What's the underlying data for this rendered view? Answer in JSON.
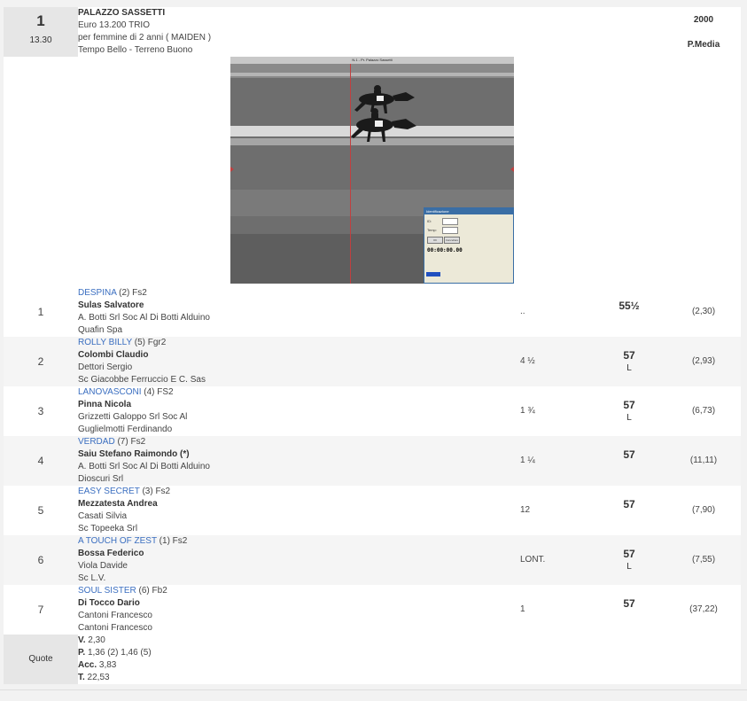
{
  "race": {
    "number": "1",
    "time": "13.30",
    "name": "PALAZZO SASSETTI",
    "prize": "Euro 13.200 TRIO",
    "conditions": "per femmine di 2 anni ( MAIDEN )",
    "weather": "Tempo Bello - Terreno Buono",
    "distance": "2000",
    "type": "P.Media"
  },
  "photo": {
    "title": "N.1 - Pr. Palazzo Sassetti",
    "dialog_title": "Identificazione",
    "field1_label": "ID:",
    "field2_label": "Temp:",
    "button1": "OK",
    "button2": "Cancellare",
    "clock": "00:00:00.00"
  },
  "runners": [
    {
      "pos": "1",
      "horse": "DESPINA",
      "extra": " (2) Fs2",
      "jockey": "Sulas Salvatore",
      "trainer": "A. Botti Srl Soc Al Di Botti Alduino",
      "owner": "Quafin Spa",
      "dist": "..",
      "weight": "55½",
      "weight_sub": "",
      "odds": "(2,30)"
    },
    {
      "pos": "2",
      "horse": "ROLLY BILLY",
      "extra": " (5) Fgr2",
      "jockey": "Colombi Claudio",
      "trainer": "Dettori Sergio",
      "owner": "Sc Giacobbe Ferruccio E C. Sas",
      "dist": "4 ½",
      "weight": "57",
      "weight_sub": "L",
      "odds": "(2,93)"
    },
    {
      "pos": "3",
      "horse": "LANOVASCONI",
      "extra": " (4) FS2",
      "jockey": "Pinna Nicola",
      "trainer": "Grizzetti Galoppo Srl Soc Al",
      "owner": "Guglielmotti Ferdinando",
      "dist": "1 ¾",
      "weight": "57",
      "weight_sub": "L",
      "odds": "(6,73)"
    },
    {
      "pos": "4",
      "horse": "VERDAD",
      "extra": " (7) Fs2",
      "jockey": "Saiu Stefano Raimondo (*)",
      "trainer": "A. Botti Srl Soc Al Di Botti Alduino",
      "owner": "Dioscuri Srl",
      "dist": "1 ¼",
      "weight": "57",
      "weight_sub": "",
      "odds": "(11,11)"
    },
    {
      "pos": "5",
      "horse": "EASY SECRET",
      "extra": " (3) Fs2",
      "jockey": "Mezzatesta Andrea",
      "trainer": "Casati Silvia",
      "owner": "Sc Topeeka Srl",
      "dist": "12",
      "weight": "57",
      "weight_sub": "",
      "odds": "(7,90)"
    },
    {
      "pos": "6",
      "horse": "A TOUCH OF ZEST",
      "extra": " (1) Fs2",
      "jockey": "Bossa Federico",
      "trainer": "Viola Davide",
      "owner": "Sc L.V.",
      "dist": "LONT.",
      "weight": "57",
      "weight_sub": "L",
      "odds": "(7,55)"
    },
    {
      "pos": "7",
      "horse": "SOUL SISTER",
      "extra": " (6) Fb2",
      "jockey": "Di Tocco Dario",
      "trainer": "Cantoni Francesco",
      "owner": "Cantoni Francesco",
      "dist": "1",
      "weight": "57",
      "weight_sub": "",
      "odds": "(37,22)"
    }
  ],
  "quote": {
    "label": "Quote",
    "v_label": "V.",
    "v_value": " 2,30",
    "p_label": "P.",
    "p_value": " 1,36 (2)  1,46 (5)",
    "acc_label": "Acc.",
    "acc_value": " 3,83",
    "t_label": "T.",
    "t_value": " 22,53"
  }
}
